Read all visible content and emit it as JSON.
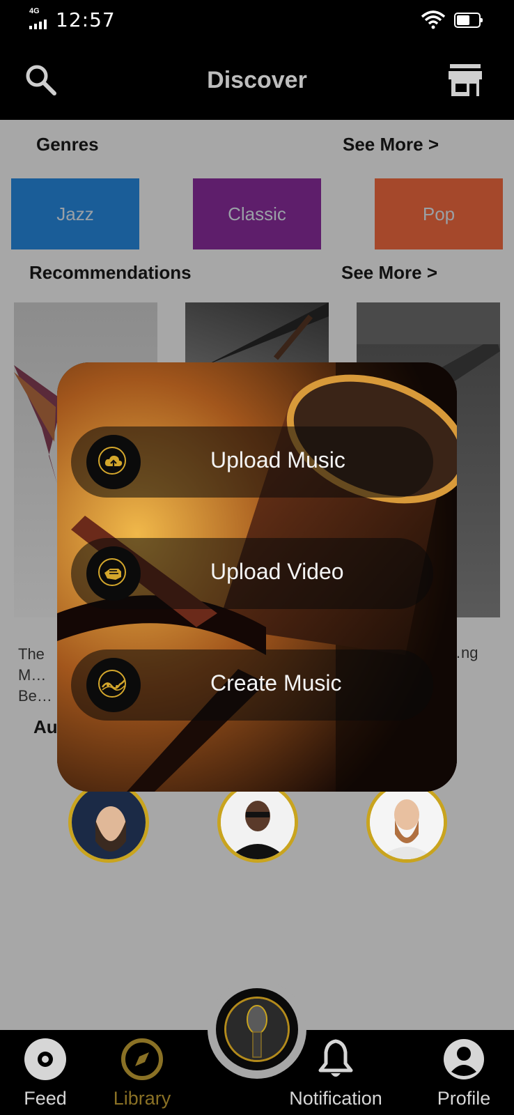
{
  "status": {
    "network": "4G",
    "time": "12:57",
    "battery": "53"
  },
  "header": {
    "title": "Discover",
    "search_icon": "search-icon",
    "store_icon": "store-icon"
  },
  "genres": {
    "title": "Genres",
    "see_more": "See More >",
    "items": [
      {
        "label": "Jazz",
        "color": "#1a5d98"
      },
      {
        "label": "Classic",
        "color": "#5e1e6b"
      },
      {
        "label": "Pop",
        "color": "#a5482b"
      }
    ]
  },
  "recommendations": {
    "title": "Recommendations",
    "see_more": "See More >",
    "items": [
      {
        "title": "The M… Be…"
      },
      {
        "title": ""
      },
      {
        "title": "…ng"
      }
    ]
  },
  "audio_section": {
    "title": "Au"
  },
  "upload_menu": {
    "items": [
      {
        "label": "Upload Music",
        "icon": "cloud-upload-icon"
      },
      {
        "label": "Upload Video",
        "icon": "video-hand-icon"
      },
      {
        "label": "Create Music",
        "icon": "music-wave-icon"
      }
    ]
  },
  "bottom_nav": {
    "items": [
      {
        "label": "Feed",
        "icon": "disc-icon",
        "active": false
      },
      {
        "label": "Library",
        "icon": "compass-icon",
        "active": true
      },
      {
        "label": "Notification",
        "icon": "bell-icon",
        "active": false
      },
      {
        "label": "Profile",
        "icon": "profile-icon",
        "active": false
      }
    ],
    "center_icon": "microphone-icon"
  },
  "colors": {
    "accent": "#c9a41e",
    "active_nav": "#8a7125",
    "inactive_nav": "#d6d6d6"
  }
}
